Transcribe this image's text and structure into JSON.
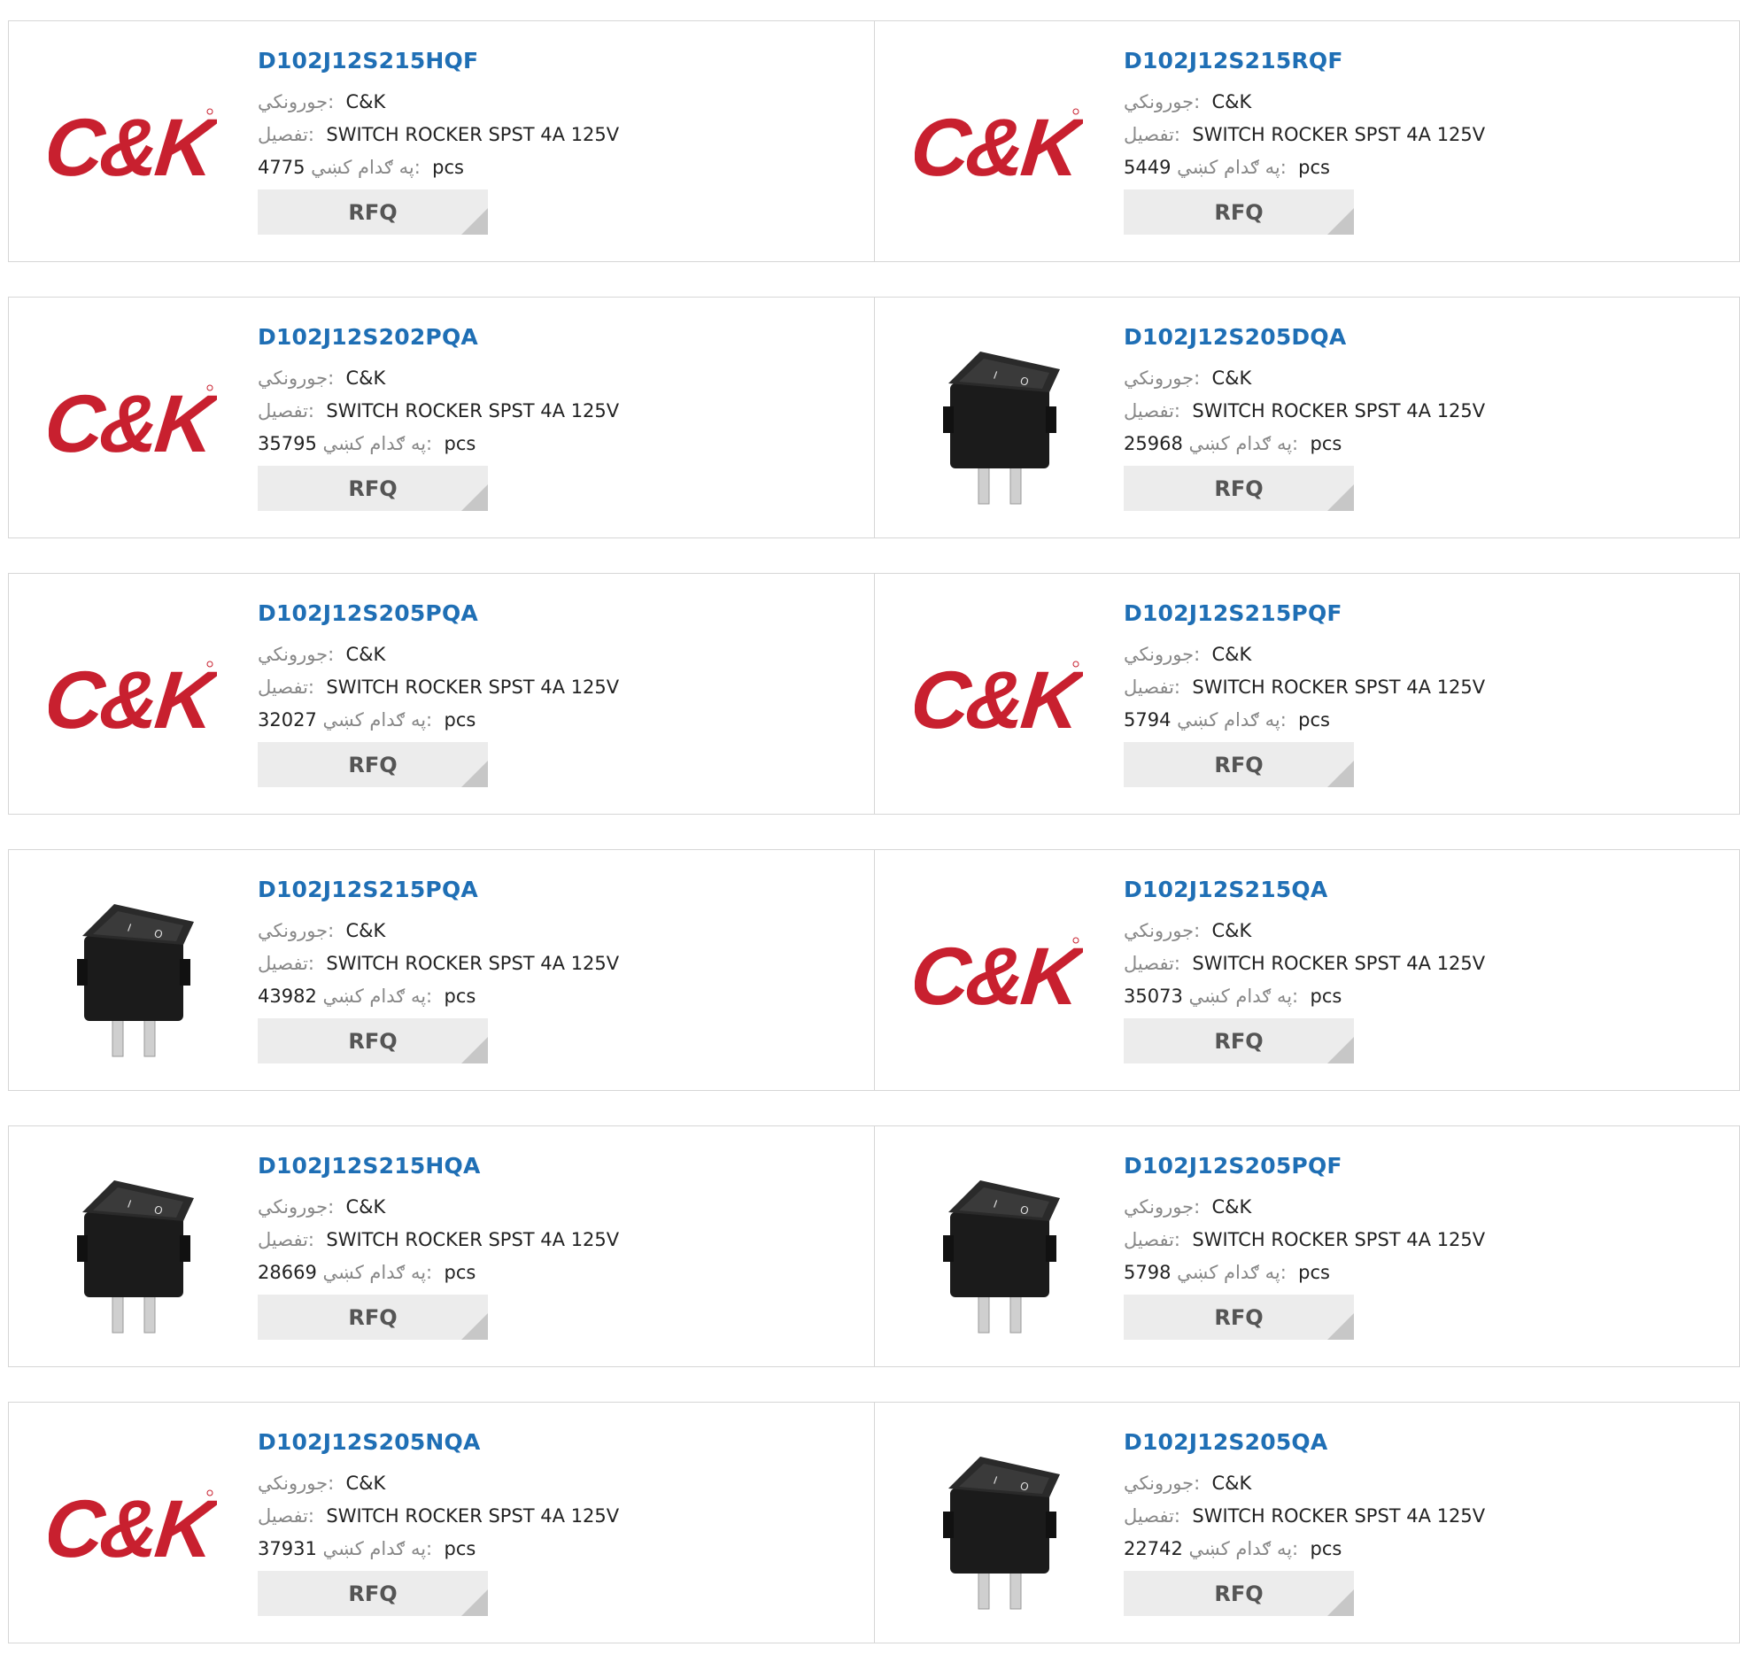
{
  "labels": {
    "manufacturer": "جورونکي:",
    "description": "تفصيل:",
    "stock": "په ګدام کښي:",
    "unit": "pcs",
    "rfq": "RFQ"
  },
  "logo_text": "C&K",
  "products": [
    {
      "part": "D102J12S215HQF",
      "mfr": "C&K",
      "desc": "SWITCH ROCKER SPST 4A 125V",
      "stock": "4775",
      "image": "ck-logo"
    },
    {
      "part": "D102J12S215RQF",
      "mfr": "C&K",
      "desc": "SWITCH ROCKER SPST 4A 125V",
      "stock": "5449",
      "image": "ck-logo"
    },
    {
      "part": "D102J12S202PQA",
      "mfr": "C&K",
      "desc": "SWITCH ROCKER SPST 4A 125V",
      "stock": "35795",
      "image": "ck-logo"
    },
    {
      "part": "D102J12S205DQA",
      "mfr": "C&K",
      "desc": "SWITCH ROCKER SPST 4A 125V",
      "stock": "25968",
      "image": "rocker-switch-photo"
    },
    {
      "part": "D102J12S205PQA",
      "mfr": "C&K",
      "desc": "SWITCH ROCKER SPST 4A 125V",
      "stock": "32027",
      "image": "ck-logo"
    },
    {
      "part": "D102J12S215PQF",
      "mfr": "C&K",
      "desc": "SWITCH ROCKER SPST 4A 125V",
      "stock": "5794",
      "image": "ck-logo"
    },
    {
      "part": "D102J12S215PQA",
      "mfr": "C&K",
      "desc": "SWITCH ROCKER SPST 4A 125V",
      "stock": "43982",
      "image": "rocker-switch-photo"
    },
    {
      "part": "D102J12S215QA",
      "mfr": "C&K",
      "desc": "SWITCH ROCKER SPST 4A 125V",
      "stock": "35073",
      "image": "ck-logo"
    },
    {
      "part": "D102J12S215HQA",
      "mfr": "C&K",
      "desc": "SWITCH ROCKER SPST 4A 125V",
      "stock": "28669",
      "image": "rocker-switch-photo"
    },
    {
      "part": "D102J12S205PQF",
      "mfr": "C&K",
      "desc": "SWITCH ROCKER SPST 4A 125V",
      "stock": "5798",
      "image": "rocker-switch-photo"
    },
    {
      "part": "D102J12S205NQA",
      "mfr": "C&K",
      "desc": "SWITCH ROCKER SPST 4A 125V",
      "stock": "37931",
      "image": "ck-logo"
    },
    {
      "part": "D102J12S205QA",
      "mfr": "C&K",
      "desc": "SWITCH ROCKER SPST 4A 125V",
      "stock": "22742",
      "image": "rocker-switch-photo"
    }
  ]
}
